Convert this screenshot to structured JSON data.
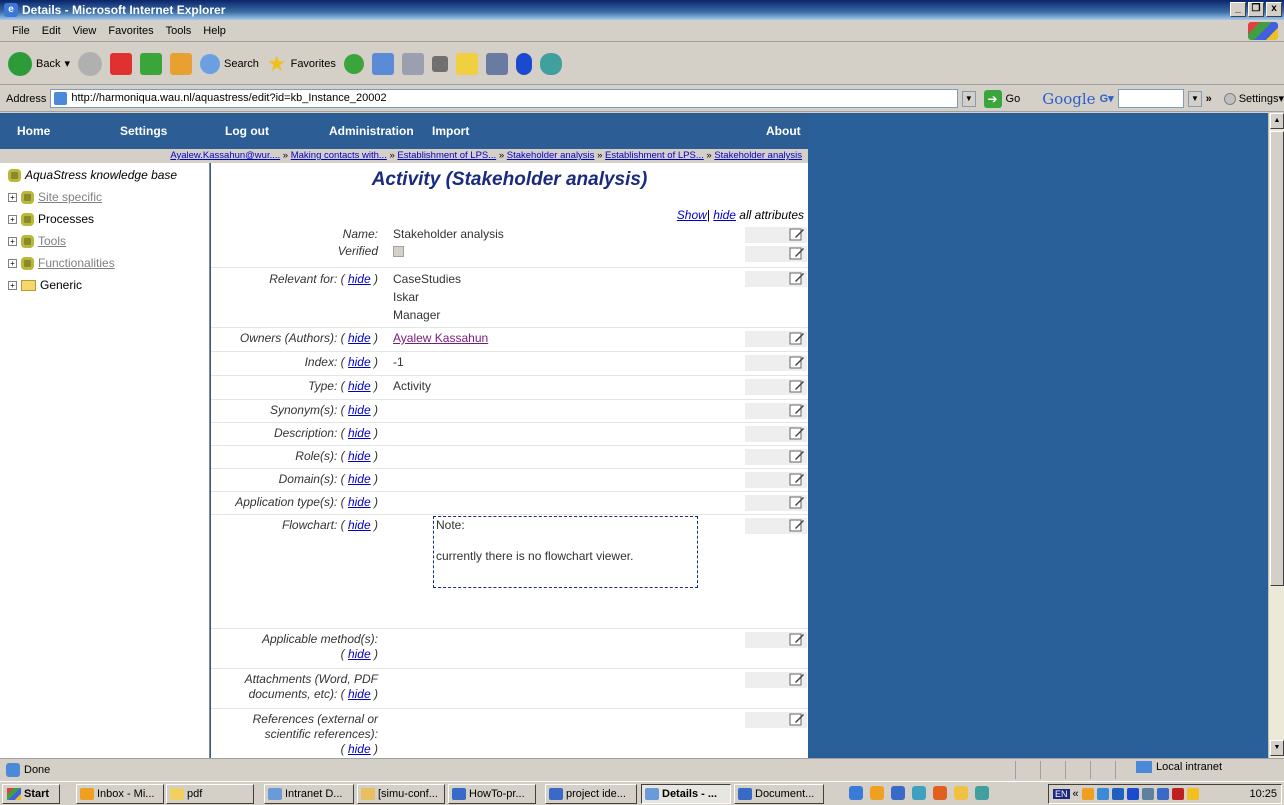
{
  "window": {
    "title": "Details - Microsoft Internet Explorer",
    "min": "_",
    "max": "❐",
    "close": "x"
  },
  "menu": [
    "File",
    "Edit",
    "View",
    "Favorites",
    "Tools",
    "Help"
  ],
  "toolbar": {
    "back": "Back",
    "search": "Search",
    "favorites": "Favorites"
  },
  "address": {
    "label": "Address",
    "url": "http://harmoniqua.wau.nl/aquastress/edit?id=kb_Instance_20002",
    "go": "Go",
    "google": "Google",
    "google_dropdown": "G▾",
    "more": "»",
    "settings": "Settings▾"
  },
  "nav": {
    "home": "Home",
    "settings": "Settings",
    "logout": "Log out",
    "administration": "Administration",
    "import": "Import",
    "about": "About"
  },
  "breadcrumbs": [
    "Ayalew.Kassahun@wur....",
    "Making contacts with...",
    "Establishment of LPS...",
    "Stakeholder analysis",
    "Establishment of LPS...",
    "Stakeholder analysis"
  ],
  "breadcrumb_sep": "»",
  "tree": {
    "root": "AquaStress knowledge base",
    "items": [
      {
        "label": "Site specific",
        "link": true
      },
      {
        "label": "Processes",
        "link": false
      },
      {
        "label": "Tools",
        "link": true
      },
      {
        "label": "Functionalities",
        "link": true
      },
      {
        "label": "Generic",
        "link": false
      }
    ]
  },
  "main": {
    "title": "Activity (Stakeholder analysis)",
    "show": "Show",
    "sep": "|",
    "hide": "hide",
    "all_attributes": "all attributes",
    "fields": {
      "name_label": "Name:",
      "name_value": "Stakeholder analysis",
      "verified_label": "Verified",
      "relevant_label": "Relevant for: (",
      "relevant_values": [
        "CaseStudies",
        "Iskar",
        "Manager"
      ],
      "owners_label": "Owners (Authors): (",
      "owners_value": "Ayalew Kassahun",
      "index_label": "Index: (",
      "index_value": "-1",
      "type_label": "Type: (",
      "type_value": "Activity",
      "synonyms_label": "Synonym(s): (",
      "description_label": "Description: (",
      "roles_label": "Role(s): (",
      "domains_label": "Domain(s): (",
      "apptype_label": "Application type(s): (",
      "flowchart_label": "Flowchart: (",
      "applicable_label_1": "Applicable method(s):",
      "applicable_label_2": "(",
      "attachments_label_1": "Attachments (Word, PDF",
      "attachments_label_2": "documents, etc): (",
      "references_label_1": "References (external or",
      "references_label_2": "scientific references):",
      "references_label_3": "(",
      "close_paren": ")"
    },
    "flowchart_note_title": "Note:",
    "flowchart_note_text": "currently there is no flowchart viewer."
  },
  "status": {
    "text": "Done",
    "zone": "Local intranet"
  },
  "taskbar": {
    "start": "Start",
    "tasks": [
      "Inbox - Mi...",
      "pdf",
      "Intranet D...",
      "[simu-conf...",
      "HowTo-pr...",
      "project ide...",
      "Details - ...",
      "Document..."
    ],
    "lang": "EN",
    "tray_arrow": "«",
    "clock": "10:25"
  },
  "colors": {
    "page_background": "#2a6099",
    "nav_background": "#2c5e95",
    "title_color": "#1a2a80",
    "link_color": "#0000cc"
  }
}
